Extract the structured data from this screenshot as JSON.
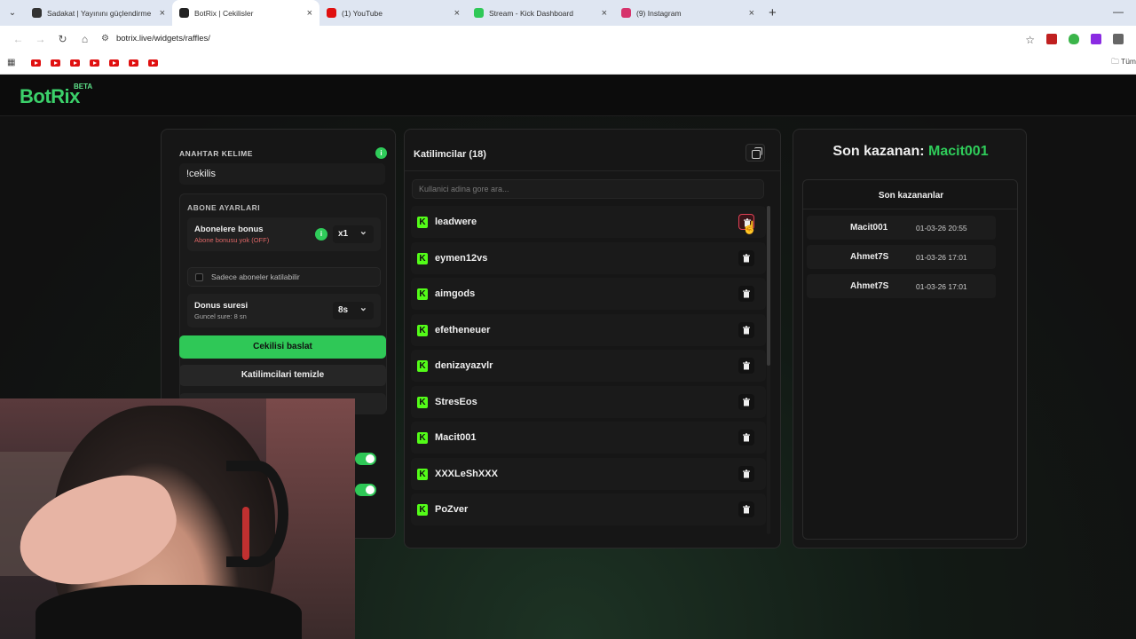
{
  "browser": {
    "tabs": [
      {
        "title": "Sadakat | Yayınını güçlendirme",
        "favicon_color": "#333333",
        "active": false
      },
      {
        "title": "BotRix | Cekilisler",
        "favicon_color": "#222222",
        "active": true
      },
      {
        "title": "(1) YouTube",
        "favicon_color": "#e01010",
        "active": false
      },
      {
        "title": "Stream - Kick Dashboard",
        "favicon_color": "#2fc857",
        "active": false
      },
      {
        "title": "(9) Instagram",
        "favicon_color": "#d6336c",
        "active": false
      }
    ],
    "url": "botrix.live/widgets/raffles/",
    "bookmarks_right": "Tüm"
  },
  "app": {
    "logo": "BotRix",
    "beta": "BETA",
    "accent": "#2fcc5a"
  },
  "settings": {
    "keyword_label": "ANAHTAR KELIME",
    "keyword_value": "!cekilis",
    "sub_section_title": "ABONE AYARLARI",
    "sub_bonus_title": "Abonelere bonus",
    "sub_bonus_status": "Abone bonusu yok (OFF)",
    "sub_bonus_multiplier": "x1",
    "only_subs_label": "Sadece aboneler katilabilir",
    "bonus_time_title": "Donus suresi",
    "bonus_time_status": "Guncel sure: 8 sn",
    "bonus_time_value": "8s",
    "start_button": "Cekilisi baslat",
    "clear_button": "Katilimcilari temizle"
  },
  "participants": {
    "title": "Katilimcilar (18)",
    "search_placeholder": "Kullanici adina gore ara...",
    "kick_badge": "K",
    "items": [
      {
        "name": "leadwere"
      },
      {
        "name": "eymen12vs"
      },
      {
        "name": "aimgods"
      },
      {
        "name": "efetheneuer"
      },
      {
        "name": "denizayazvlr"
      },
      {
        "name": "StresEos"
      },
      {
        "name": "Macit001"
      },
      {
        "name": "XXXLeShXXX"
      },
      {
        "name": "PoZver"
      }
    ]
  },
  "winners": {
    "last_winner_label": "Son kazanan:",
    "last_winner_name": "Macit001",
    "list_title": "Son kazananlar",
    "items": [
      {
        "name": "Macit001",
        "date": "01-03-26 20:55"
      },
      {
        "name": "Ahmet7S",
        "date": "01-03-26 17:01"
      },
      {
        "name": "Ahmet7S",
        "date": "01-03-26 17:01"
      }
    ]
  }
}
